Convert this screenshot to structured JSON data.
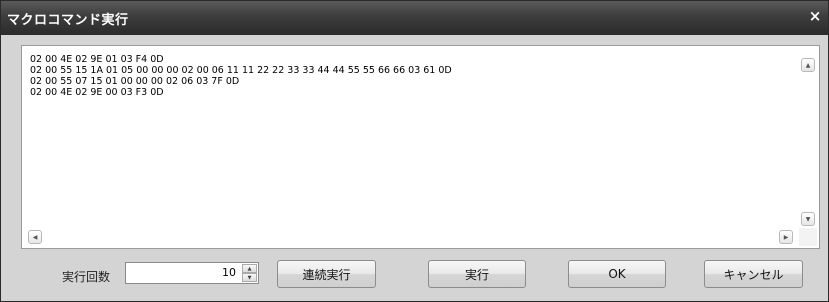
{
  "window": {
    "title": "マクロコマンド実行",
    "close_label": "×"
  },
  "editor": {
    "text": "02 00 4E 02 9E 01 03 F4 0D\n02 00 55 15 1A 01 05 00 00 00 02 00 06 11 11 22 22 33 33 44 44 55 55 66 66 03 61 0D\n02 00 55 07 15 01 00 00 00 02 06 03 7F 0D\n02 00 4E 02 9E 00 03 F3 0D",
    "scroll_up_glyph": "▲",
    "scroll_down_glyph": "▼",
    "scroll_left_glyph": "◀",
    "scroll_right_glyph": "▶"
  },
  "controls": {
    "repeat_label": "実行回数",
    "repeat_value": "10",
    "spin_up_glyph": "▲",
    "spin_down_glyph": "▼",
    "continuous_button": "連続実行",
    "execute_button": "実行",
    "ok_button": "OK",
    "cancel_button": "キャンセル"
  },
  "colors": {
    "titlebar": "#3d3d3d",
    "dialog_background": "#d4d4d4",
    "editor_background": "#ffffff"
  }
}
